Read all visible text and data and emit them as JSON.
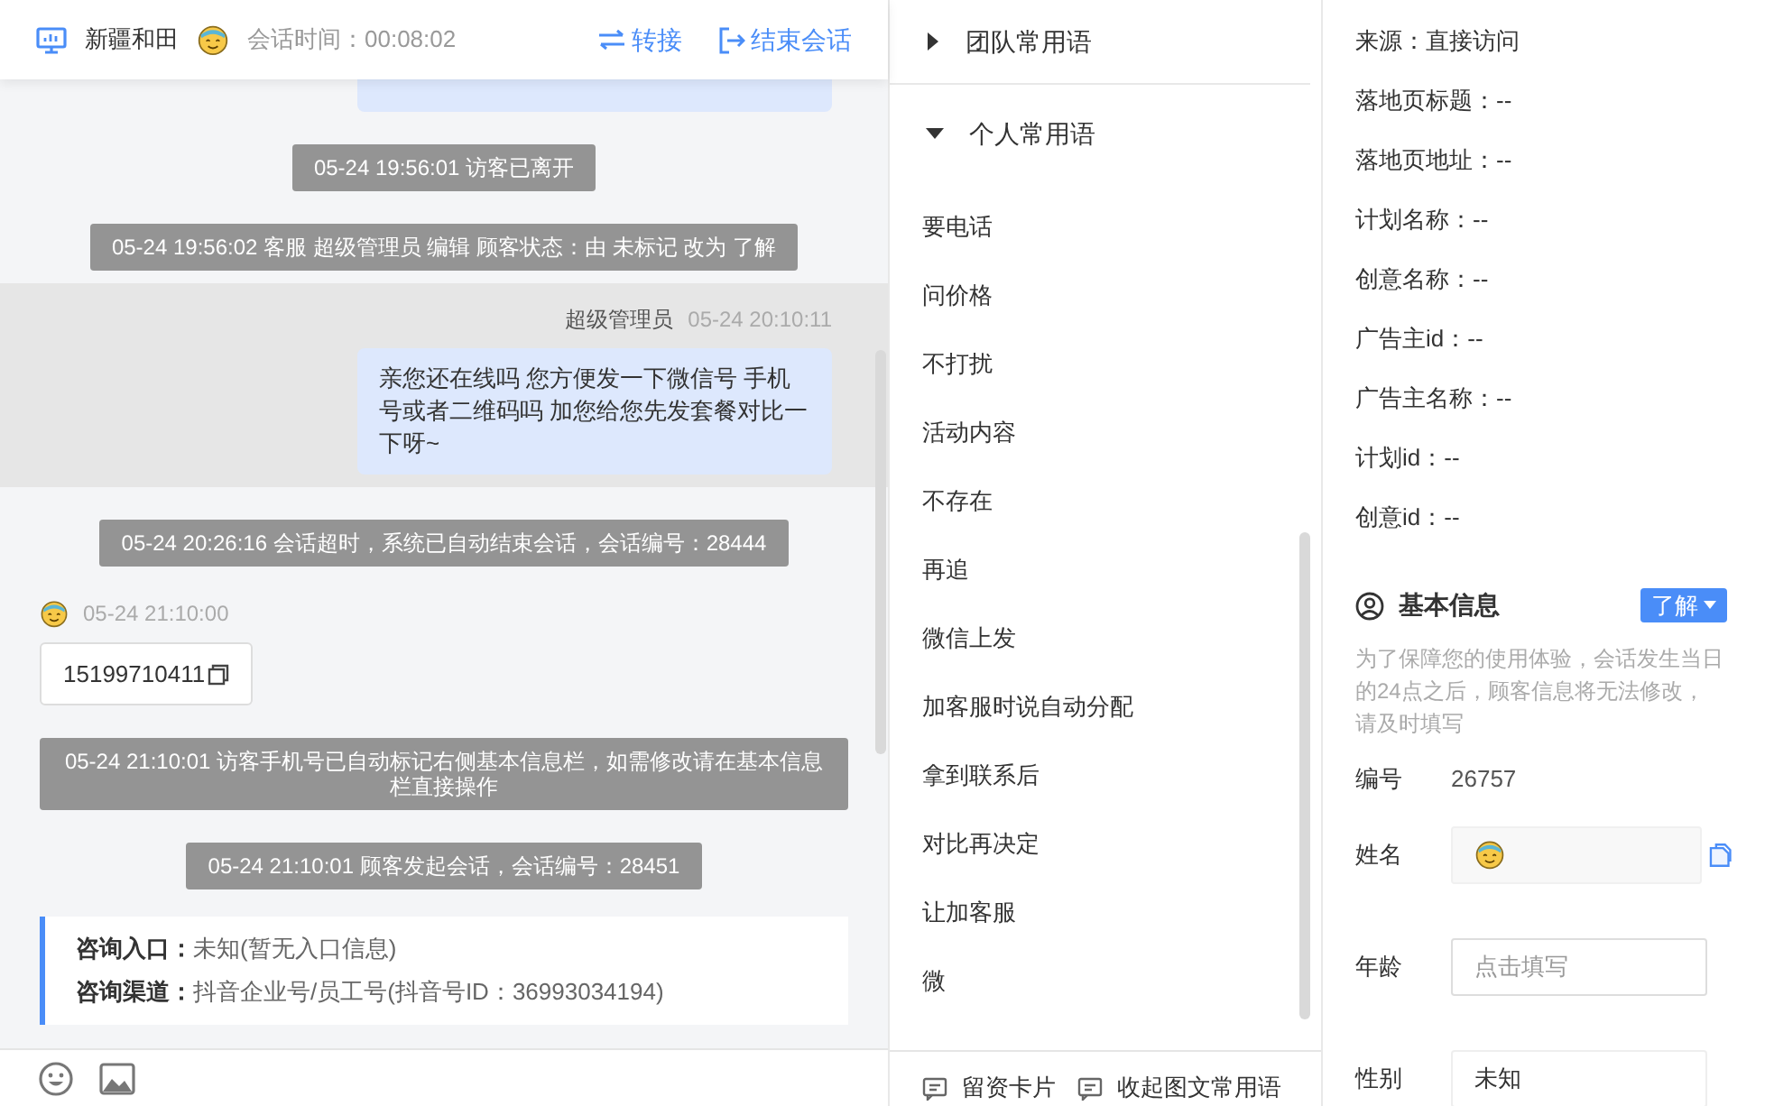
{
  "chat_header": {
    "visitor_name": "新疆和田",
    "session_time": "会话时间：00:08:02",
    "actions": [
      {
        "kind": "transfer",
        "label": "转接"
      },
      {
        "kind": "end",
        "label": "结束会话"
      }
    ]
  },
  "messages": [
    {
      "kind": "agent_cut"
    },
    {
      "kind": "system",
      "text": "05-24 19:56:01 访客已离开"
    },
    {
      "kind": "system",
      "text": "05-24 19:56:02 客服 超级管理员 编辑 顾客状态：由 未标记 改为 了解"
    },
    {
      "kind": "agent",
      "sender": "超级管理员",
      "time": "05-24 20:10:11",
      "text": "亲您还在线吗 您方便发一下微信号 手机号或者二维码吗 加您给您先发套餐对比一下呀~",
      "highlighted": true
    },
    {
      "kind": "system",
      "text": "05-24 20:26:16 会话超时，系统已自动结束会话，会话编号：28444"
    },
    {
      "kind": "visitor",
      "time": "05-24 21:10:00",
      "text": "15199710411"
    },
    {
      "kind": "system",
      "text": "05-24 21:10:01 访客手机号已自动标记右侧基本信息栏，如需修改请在基本信息栏直接操作"
    },
    {
      "kind": "system",
      "text": "05-24 21:10:01 顾客发起会话，会话编号：28451"
    },
    {
      "kind": "info",
      "rows": [
        {
          "label": "咨询入口：",
          "value": "未知(暂无入口信息)"
        },
        {
          "label": "咨询渠道：",
          "value": "抖音企业号/员工号(抖音号ID：36993034194)"
        }
      ]
    }
  ],
  "phrases": {
    "groups": [
      {
        "label": "团队常用语",
        "expanded": false
      },
      {
        "label": "个人常用语",
        "expanded": true
      }
    ],
    "items": [
      "要电话",
      "问价格",
      "不打扰",
      "活动内容",
      "不存在",
      "再追",
      "微信上发",
      "加客服时说自动分配",
      "拿到联系后",
      "对比再决定",
      "让加客服",
      "微"
    ],
    "footer": [
      "留资卡片",
      "收起图文常用语"
    ]
  },
  "visit_info": [
    "来源：直接访问",
    "落地页标题：--",
    "落地页地址：--",
    "计划名称：--",
    "创意名称：--",
    "广告主id：--",
    "广告主名称：--",
    "计划id：--",
    "创意id：--"
  ],
  "basic_info": {
    "title": "基本信息",
    "status_button": "了解",
    "note": "为了保障您的使用体验，会话发生当日的24点之后，顾客信息将无法修改，请及时填写",
    "fields": [
      {
        "kind": "text",
        "label": "编号",
        "value": "26757"
      },
      {
        "kind": "avatar",
        "label": "姓名"
      },
      {
        "kind": "input",
        "label": "年龄",
        "placeholder": "点击填写"
      },
      {
        "kind": "select",
        "label": "性别",
        "value": "未知"
      }
    ]
  }
}
